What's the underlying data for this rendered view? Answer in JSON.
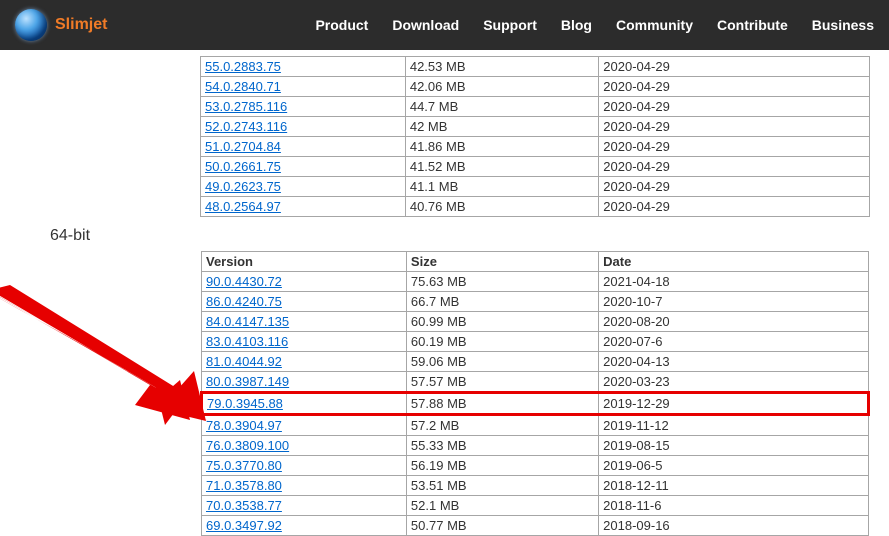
{
  "brand": "Slimjet",
  "nav": [
    "Product",
    "Download",
    "Support",
    "Blog",
    "Community",
    "Contribute",
    "Business"
  ],
  "section_label_64": "64-bit",
  "table1": {
    "rows": [
      {
        "v": "55.0.2883.75",
        "s": "42.53 MB",
        "d": "2020-04-29"
      },
      {
        "v": "54.0.2840.71",
        "s": "42.06 MB",
        "d": "2020-04-29"
      },
      {
        "v": "53.0.2785.116",
        "s": "44.7 MB",
        "d": "2020-04-29"
      },
      {
        "v": "52.0.2743.116",
        "s": "42 MB",
        "d": "2020-04-29"
      },
      {
        "v": "51.0.2704.84",
        "s": "41.86 MB",
        "d": "2020-04-29"
      },
      {
        "v": "50.0.2661.75",
        "s": "41.52 MB",
        "d": "2020-04-29"
      },
      {
        "v": "49.0.2623.75",
        "s": "41.1 MB",
        "d": "2020-04-29"
      },
      {
        "v": "48.0.2564.97",
        "s": "40.76 MB",
        "d": "2020-04-29"
      }
    ]
  },
  "table2": {
    "headers": {
      "v": "Version",
      "s": "Size",
      "d": "Date"
    },
    "highlight_version": "79.0.3945.88",
    "rows": [
      {
        "v": "90.0.4430.72",
        "s": "75.63 MB",
        "d": "2021-04-18"
      },
      {
        "v": "86.0.4240.75",
        "s": "66.7 MB",
        "d": "2020-10-7"
      },
      {
        "v": "84.0.4147.135",
        "s": "60.99 MB",
        "d": "2020-08-20"
      },
      {
        "v": "83.0.4103.116",
        "s": "60.19 MB",
        "d": "2020-07-6"
      },
      {
        "v": "81.0.4044.92",
        "s": "59.06 MB",
        "d": "2020-04-13"
      },
      {
        "v": "80.0.3987.149",
        "s": "57.57 MB",
        "d": "2020-03-23"
      },
      {
        "v": "79.0.3945.88",
        "s": "57.88 MB",
        "d": "2019-12-29"
      },
      {
        "v": "78.0.3904.97",
        "s": "57.2 MB",
        "d": "2019-11-12"
      },
      {
        "v": "76.0.3809.100",
        "s": "55.33 MB",
        "d": "2019-08-15"
      },
      {
        "v": "75.0.3770.80",
        "s": "56.19 MB",
        "d": "2019-06-5"
      },
      {
        "v": "71.0.3578.80",
        "s": "53.51 MB",
        "d": "2018-12-11"
      },
      {
        "v": "70.0.3538.77",
        "s": "52.1 MB",
        "d": "2018-11-6"
      },
      {
        "v": "69.0.3497.92",
        "s": "50.77 MB",
        "d": "2018-09-16"
      }
    ]
  }
}
